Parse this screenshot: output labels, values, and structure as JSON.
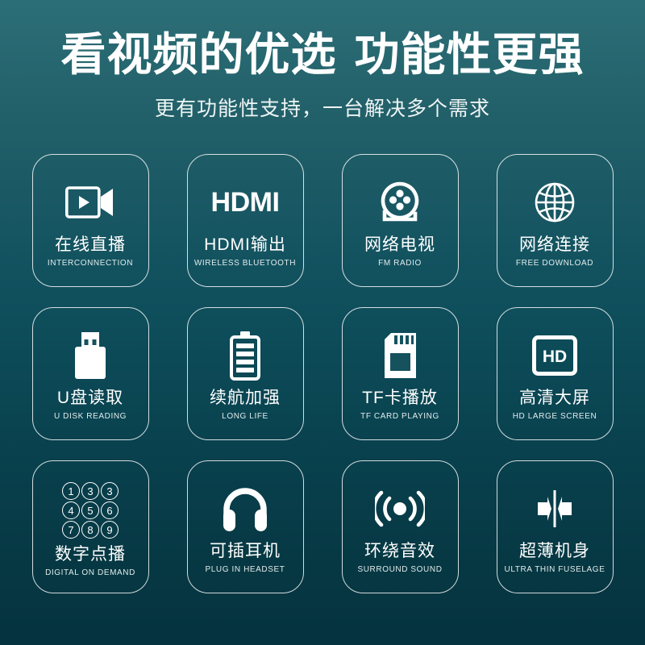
{
  "header": {
    "title_part1": "看视频的优选",
    "title_part2": "功能性更强",
    "subtitle": "更有功能性支持，一台解决多个需求"
  },
  "colors": {
    "background_top": "#2c6e77",
    "background_mid": "#0d4c59",
    "background_bottom": "#053340",
    "text": "#ffffff",
    "card_border": "rgba(255,255,255,0.82)"
  },
  "keypad": {
    "rows": [
      [
        "1",
        "3",
        "3"
      ],
      [
        "4",
        "5",
        "6"
      ],
      [
        "7",
        "8",
        "9"
      ]
    ]
  },
  "features": [
    {
      "icon": "video-camera-icon",
      "label_cn": "在线直播",
      "label_en": "INTERCONNECTION"
    },
    {
      "icon": "hdmi-text-icon",
      "label_cn": "HDMI输出",
      "label_en": "WIRELESS BLUETOOTH",
      "icon_text": "HDMI"
    },
    {
      "icon": "film-reel-icon",
      "label_cn": "网络电视",
      "label_en": "FM RADIO"
    },
    {
      "icon": "globe-icon",
      "label_cn": "网络连接",
      "label_en": "FREE DOWNLOAD"
    },
    {
      "icon": "usb-drive-icon",
      "label_cn": "U盘读取",
      "label_en": "U DISK READING"
    },
    {
      "icon": "battery-icon",
      "label_cn": "续航加强",
      "label_en": "LONG LIFE"
    },
    {
      "icon": "memory-card-icon",
      "label_cn": "TF卡播放",
      "label_en": "TF CARD PLAYING"
    },
    {
      "icon": "hd-box-icon",
      "label_cn": "高清大屏",
      "label_en": "HD LARGE SCREEN",
      "icon_text": "HD"
    },
    {
      "icon": "number-keypad-icon",
      "label_cn": "数字点播",
      "label_en": "DIGITAL ON DEMAND"
    },
    {
      "icon": "headphones-icon",
      "label_cn": "可插耳机",
      "label_en": "PLUG IN HEADSET"
    },
    {
      "icon": "surround-sound-icon",
      "label_cn": "环绕音效",
      "label_en": "SURROUND SOUND"
    },
    {
      "icon": "ultra-thin-icon",
      "label_cn": "超薄机身",
      "label_en": "ULTRA THIN FUSELAGE"
    }
  ]
}
